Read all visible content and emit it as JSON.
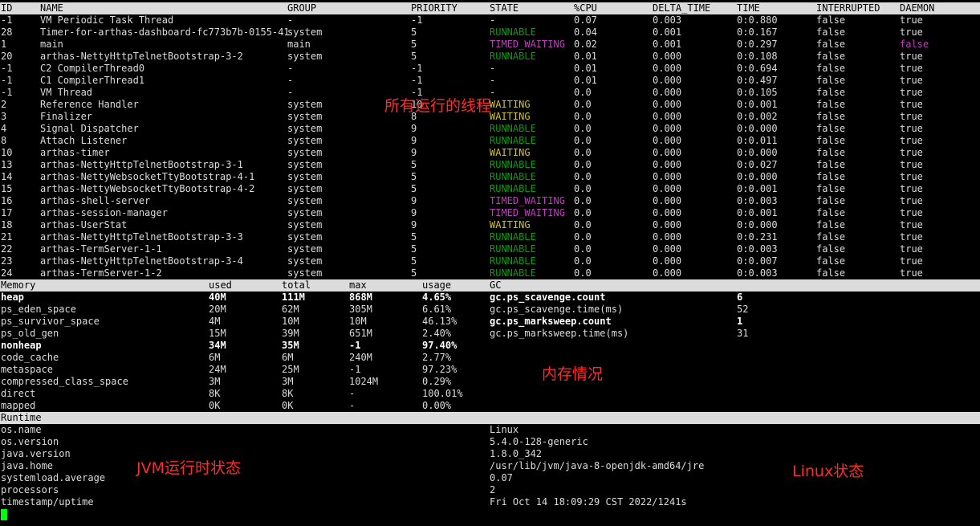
{
  "threads": {
    "headers": [
      "ID",
      "NAME",
      "GROUP",
      "PRIORITY",
      "STATE",
      "%CPU",
      "DELTA_TIME",
      "TIME",
      "INTERRUPTED",
      "DAEMON"
    ],
    "rows": [
      [
        "-1",
        "VM Periodic Task Thread",
        "-",
        "-1",
        "-",
        "0.07",
        "0.003",
        "0:0.880",
        "false",
        "true"
      ],
      [
        "28",
        "Timer-for-arthas-dashboard-fc773b7b-0155-41",
        "system",
        "5",
        "RUNNABLE",
        "0.04",
        "0.001",
        "0:0.167",
        "false",
        "true"
      ],
      [
        "1",
        "main",
        "main",
        "5",
        "TIMED_WAITING",
        "0.02",
        "0.001",
        "0:0.297",
        "false",
        "false"
      ],
      [
        "20",
        "arthas-NettyHttpTelnetBootstrap-3-2",
        "system",
        "5",
        "RUNNABLE",
        "0.01",
        "0.000",
        "0:0.108",
        "false",
        "true"
      ],
      [
        "-1",
        "C2 CompilerThread0",
        "-",
        "-1",
        "-",
        "0.01",
        "0.000",
        "0:0.694",
        "false",
        "true"
      ],
      [
        "-1",
        "C1 CompilerThread1",
        "-",
        "-1",
        "-",
        "0.01",
        "0.000",
        "0:0.497",
        "false",
        "true"
      ],
      [
        "-1",
        "VM Thread",
        "-",
        "-1",
        "-",
        "0.0",
        "0.000",
        "0:0.105",
        "false",
        "true"
      ],
      [
        "2",
        "Reference Handler",
        "system",
        "10",
        "WAITING",
        "0.0",
        "0.000",
        "0:0.001",
        "false",
        "true"
      ],
      [
        "3",
        "Finalizer",
        "system",
        "8",
        "WAITING",
        "0.0",
        "0.000",
        "0:0.002",
        "false",
        "true"
      ],
      [
        "4",
        "Signal Dispatcher",
        "system",
        "9",
        "RUNNABLE",
        "0.0",
        "0.000",
        "0:0.000",
        "false",
        "true"
      ],
      [
        "8",
        "Attach Listener",
        "system",
        "9",
        "RUNNABLE",
        "0.0",
        "0.000",
        "0:0.011",
        "false",
        "true"
      ],
      [
        "10",
        "arthas-timer",
        "system",
        "9",
        "WAITING",
        "0.0",
        "0.000",
        "0:0.000",
        "false",
        "true"
      ],
      [
        "13",
        "arthas-NettyHttpTelnetBootstrap-3-1",
        "system",
        "5",
        "RUNNABLE",
        "0.0",
        "0.000",
        "0:0.027",
        "false",
        "true"
      ],
      [
        "14",
        "arthas-NettyWebsocketTtyBootstrap-4-1",
        "system",
        "5",
        "RUNNABLE",
        "0.0",
        "0.000",
        "0:0.000",
        "false",
        "true"
      ],
      [
        "15",
        "arthas-NettyWebsocketTtyBootstrap-4-2",
        "system",
        "5",
        "RUNNABLE",
        "0.0",
        "0.000",
        "0:0.001",
        "false",
        "true"
      ],
      [
        "16",
        "arthas-shell-server",
        "system",
        "9",
        "TIMED_WAITING",
        "0.0",
        "0.000",
        "0:0.003",
        "false",
        "true"
      ],
      [
        "17",
        "arthas-session-manager",
        "system",
        "9",
        "TIMED_WAITING",
        "0.0",
        "0.000",
        "0:0.001",
        "false",
        "true"
      ],
      [
        "18",
        "arthas-UserStat",
        "system",
        "9",
        "WAITING",
        "0.0",
        "0.000",
        "0:0.000",
        "false",
        "true"
      ],
      [
        "21",
        "arthas-NettyHttpTelnetBootstrap-3-3",
        "system",
        "5",
        "RUNNABLE",
        "0.0",
        "0.000",
        "0:0.231",
        "false",
        "true"
      ],
      [
        "22",
        "arthas-TermServer-1-1",
        "system",
        "5",
        "RUNNABLE",
        "0.0",
        "0.000",
        "0:0.003",
        "false",
        "true"
      ],
      [
        "23",
        "arthas-NettyHttpTelnetBootstrap-3-4",
        "system",
        "5",
        "RUNNABLE",
        "0.0",
        "0.000",
        "0:0.007",
        "false",
        "true"
      ],
      [
        "24",
        "arthas-TermServer-1-2",
        "system",
        "5",
        "RUNNABLE",
        "0.0",
        "0.000",
        "0:0.003",
        "false",
        "true"
      ]
    ]
  },
  "memory": {
    "headers": [
      "Memory",
      "used",
      "total",
      "max",
      "usage",
      "GC"
    ],
    "rows": [
      [
        "heap",
        "40M",
        "111M",
        "868M",
        "4.65%"
      ],
      [
        "ps_eden_space",
        "20M",
        "62M",
        "305M",
        "6.61%"
      ],
      [
        "ps_survivor_space",
        "4M",
        "10M",
        "10M",
        "46.13%"
      ],
      [
        "ps_old_gen",
        "15M",
        "39M",
        "651M",
        "2.40%"
      ],
      [
        "nonheap",
        "34M",
        "35M",
        "-1",
        "97.40%"
      ],
      [
        "code_cache",
        "6M",
        "6M",
        "240M",
        "2.77%"
      ],
      [
        "metaspace",
        "24M",
        "25M",
        "-1",
        "97.23%"
      ],
      [
        "compressed_class_space",
        "3M",
        "3M",
        "1024M",
        "0.29%"
      ],
      [
        "direct",
        "8K",
        "8K",
        "-",
        "100.01%"
      ],
      [
        "mapped",
        "0K",
        "0K",
        "-",
        "0.00%"
      ]
    ],
    "gc": [
      [
        "gc.ps_scavenge.count",
        "6"
      ],
      [
        "gc.ps_scavenge.time(ms)",
        "52"
      ],
      [
        "gc.ps_marksweep.count",
        "1"
      ],
      [
        "gc.ps_marksweep.time(ms)",
        "31"
      ]
    ]
  },
  "runtime": {
    "header": "Runtime",
    "rows": [
      [
        "os.name",
        "Linux"
      ],
      [
        "os.version",
        "5.4.0-128-generic"
      ],
      [
        "java.version",
        "1.8.0_342"
      ],
      [
        "java.home",
        "/usr/lib/jvm/java-8-openjdk-amd64/jre"
      ],
      [
        "systemload.average",
        "0.07"
      ],
      [
        "processors",
        "2"
      ],
      [
        "timestamp/uptime",
        "Fri Oct 14 18:09:29 CST 2022/1241s"
      ]
    ]
  },
  "annotations": {
    "threads": "所有运行的线程",
    "memory": "内存情况",
    "jvm": "JVM运行时状态",
    "linux": "Linux状态"
  },
  "colors": {
    "RUNNABLE": "#0a9c0a",
    "TIMED_WAITING": "#c23bc2",
    "WAITING": "#d0c32a",
    "annotation": "#ff2a2a",
    "header_bg": "#dcdcdc"
  }
}
